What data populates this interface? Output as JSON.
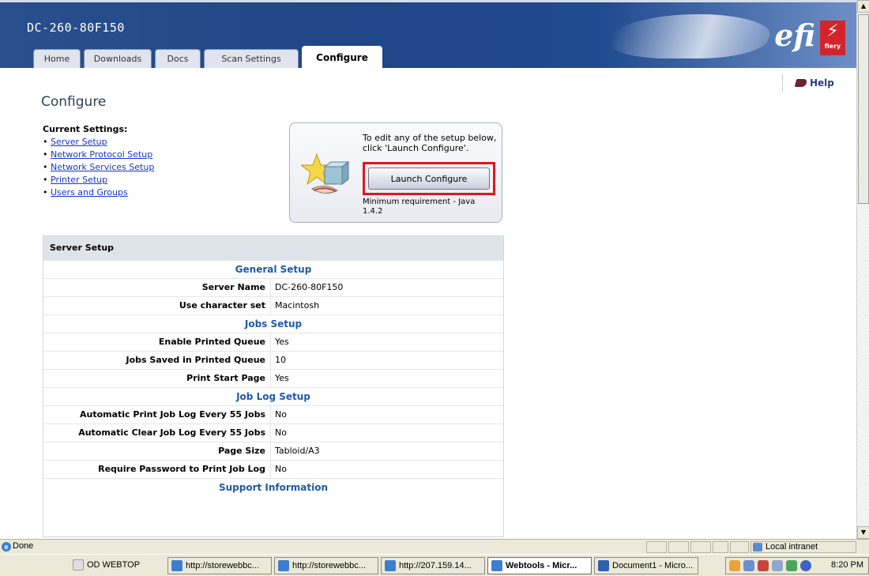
{
  "header": {
    "device_name": "DC-260-80F150",
    "tabs": [
      {
        "label": "Home"
      },
      {
        "label": "Downloads"
      },
      {
        "label": "Docs"
      },
      {
        "label": "Scan Settings"
      },
      {
        "label": "Configure",
        "active": true
      }
    ],
    "brand": {
      "efi": "efi",
      "fiery": "fiery",
      "fiery_color": "#d3242c"
    }
  },
  "help": {
    "label": "Help"
  },
  "page_title": "Configure",
  "current_settings": {
    "label": "Current Settings:",
    "links": [
      "Server Setup",
      "Network Protocol Setup",
      "Network Services Setup",
      "Printer Setup",
      "Users and Groups"
    ]
  },
  "launch": {
    "instruction": "To edit any of the setup below, click 'Launch Configure'.",
    "button_label": "Launch Configure",
    "requirement": "Minimum requirement - Java 1.4.2",
    "highlight_color": "#e2161c"
  },
  "server_setup": {
    "title": "Server Setup",
    "rows": [
      {
        "section": "General Setup"
      },
      {
        "key": "Server Name",
        "value": "DC-260-80F150"
      },
      {
        "key": "Use character set",
        "value": "Macintosh"
      },
      {
        "section": "Jobs Setup"
      },
      {
        "key": "Enable Printed Queue",
        "value": "Yes"
      },
      {
        "key": "Jobs Saved in Printed Queue",
        "value": "10"
      },
      {
        "key": "Print Start Page",
        "value": "Yes"
      },
      {
        "section": "Job Log Setup"
      },
      {
        "key": "Automatic Print Job Log Every 55 Jobs",
        "value": "No"
      },
      {
        "key": "Automatic Clear Job Log Every 55 Jobs",
        "value": "No"
      },
      {
        "key": "Page Size",
        "value": "Tabloid/A3"
      },
      {
        "key": "Require Password to Print Job Log",
        "value": "No"
      },
      {
        "section": "Support Information"
      }
    ]
  },
  "statusbar": {
    "status": "Done",
    "zone": "Local intranet"
  },
  "taskbar": {
    "tasks": [
      {
        "label": "OD WEBTOP",
        "icon": "blank-icon"
      },
      {
        "label": "http://storewebbc...",
        "icon": "ie-icon"
      },
      {
        "label": "http://storewebbc...",
        "icon": "ie-icon"
      },
      {
        "label": "http://207.159.14...",
        "icon": "ie-icon"
      },
      {
        "label": "Webtools - Micr...",
        "icon": "ie-icon",
        "active": true
      },
      {
        "label": "Document1 - Micro...",
        "icon": "word-icon"
      }
    ],
    "clock": "8:20 PM"
  }
}
